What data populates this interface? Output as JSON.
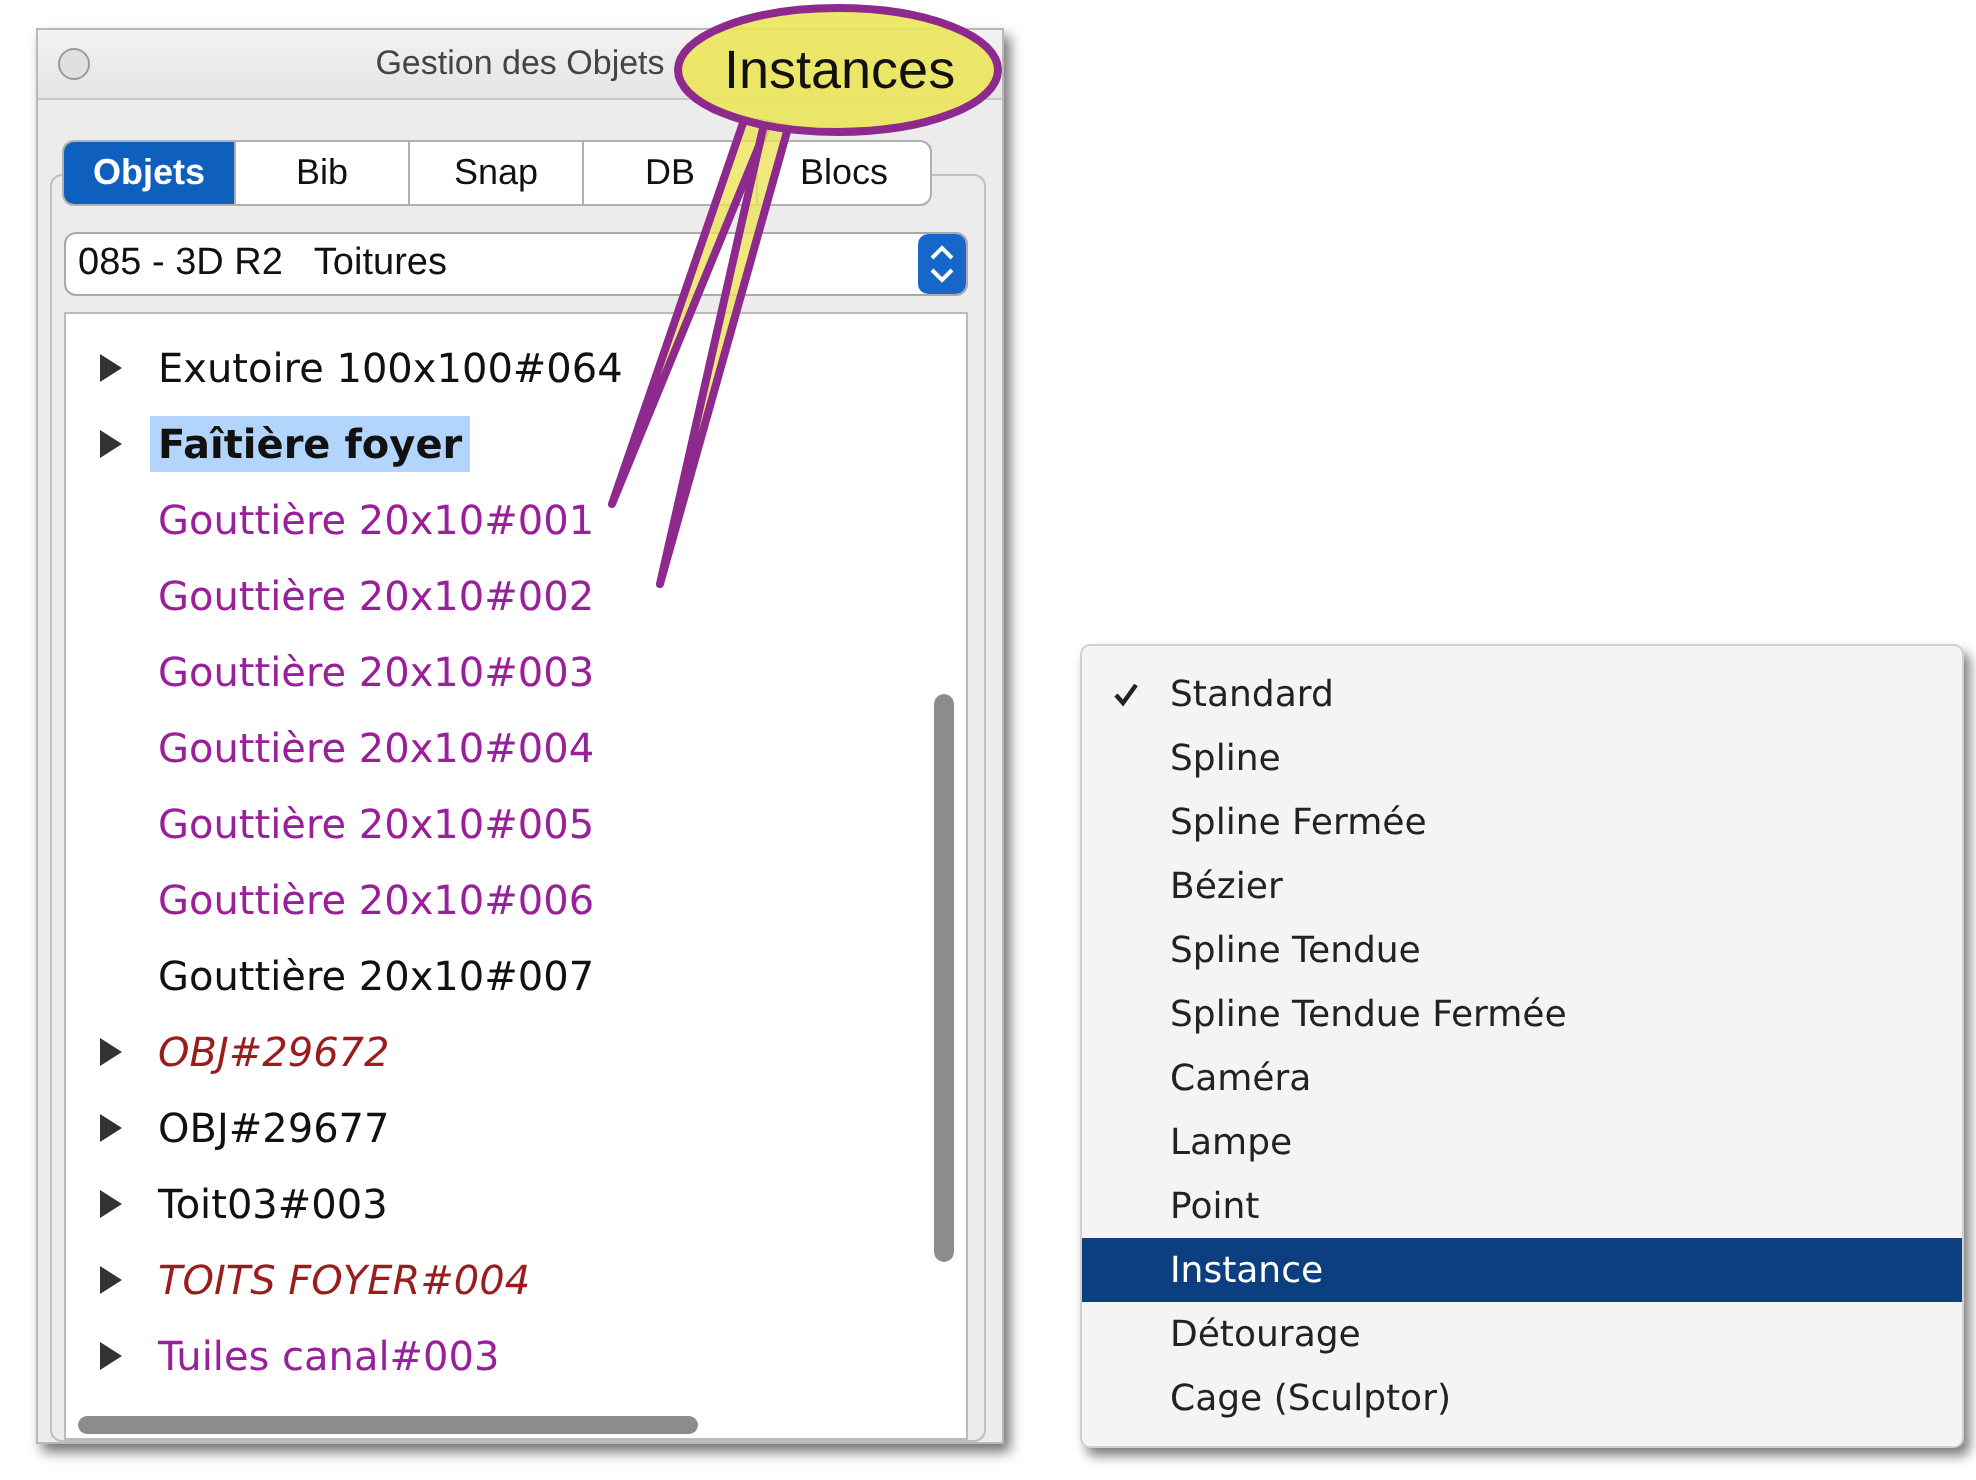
{
  "window": {
    "title": "Gestion des Objets"
  },
  "tabs": [
    {
      "label": "Objets",
      "selected": true
    },
    {
      "label": "Bib",
      "selected": false
    },
    {
      "label": "Snap",
      "selected": false
    },
    {
      "label": "DB",
      "selected": false
    },
    {
      "label": "Blocs",
      "selected": false
    }
  ],
  "library_select": {
    "value": "085 - 3D R2   Toitures"
  },
  "tree": [
    {
      "label": "Exutoire 100x100#064",
      "kind": "group",
      "expanded": false,
      "selected": false,
      "color": "#111111",
      "italic": false
    },
    {
      "label": "Faîtière foyer",
      "kind": "group",
      "expanded": false,
      "selected": true,
      "color": "#111111",
      "italic": false
    },
    {
      "label": "Gouttière 20x10#001",
      "kind": "leaf",
      "selected": false,
      "color": "#9a1f9a",
      "italic": false
    },
    {
      "label": "Gouttière 20x10#002",
      "kind": "leaf",
      "selected": false,
      "color": "#9a1f9a",
      "italic": false
    },
    {
      "label": "Gouttière 20x10#003",
      "kind": "leaf",
      "selected": false,
      "color": "#9a1f9a",
      "italic": false
    },
    {
      "label": "Gouttière 20x10#004",
      "kind": "leaf",
      "selected": false,
      "color": "#9a1f9a",
      "italic": false
    },
    {
      "label": "Gouttière 20x10#005",
      "kind": "leaf",
      "selected": false,
      "color": "#9a1f9a",
      "italic": false
    },
    {
      "label": "Gouttière 20x10#006",
      "kind": "leaf",
      "selected": false,
      "color": "#9a1f9a",
      "italic": false
    },
    {
      "label": "Gouttière 20x10#007",
      "kind": "leaf",
      "selected": false,
      "color": "#111111",
      "italic": false
    },
    {
      "label": "OBJ#29672",
      "kind": "group",
      "expanded": false,
      "selected": false,
      "color": "#9b1c1c",
      "italic": true
    },
    {
      "label": "OBJ#29677",
      "kind": "group",
      "expanded": false,
      "selected": false,
      "color": "#111111",
      "italic": false
    },
    {
      "label": "Toit03#003",
      "kind": "group",
      "expanded": false,
      "selected": false,
      "color": "#111111",
      "italic": false
    },
    {
      "label": "TOITS FOYER#004",
      "kind": "group",
      "expanded": false,
      "selected": false,
      "color": "#9b1c1c",
      "italic": true
    },
    {
      "label": "Tuiles canal#003",
      "kind": "group",
      "expanded": false,
      "selected": false,
      "color": "#9a1f9a",
      "italic": false
    }
  ],
  "callout": {
    "label": "Instances"
  },
  "menu": [
    {
      "label": "Standard",
      "checked": true,
      "selected": false
    },
    {
      "label": "Spline",
      "checked": false,
      "selected": false
    },
    {
      "label": "Spline Fermée",
      "checked": false,
      "selected": false
    },
    {
      "label": "Bézier",
      "checked": false,
      "selected": false
    },
    {
      "label": "Spline Tendue",
      "checked": false,
      "selected": false
    },
    {
      "label": "Spline Tendue Fermée",
      "checked": false,
      "selected": false
    },
    {
      "label": "Caméra",
      "checked": false,
      "selected": false
    },
    {
      "label": "Lampe",
      "checked": false,
      "selected": false
    },
    {
      "label": "Point",
      "checked": false,
      "selected": false
    },
    {
      "label": "Instance",
      "checked": false,
      "selected": true
    },
    {
      "label": "Détourage",
      "checked": false,
      "selected": false
    },
    {
      "label": "Cage (Sculptor)",
      "checked": false,
      "selected": false
    }
  ]
}
